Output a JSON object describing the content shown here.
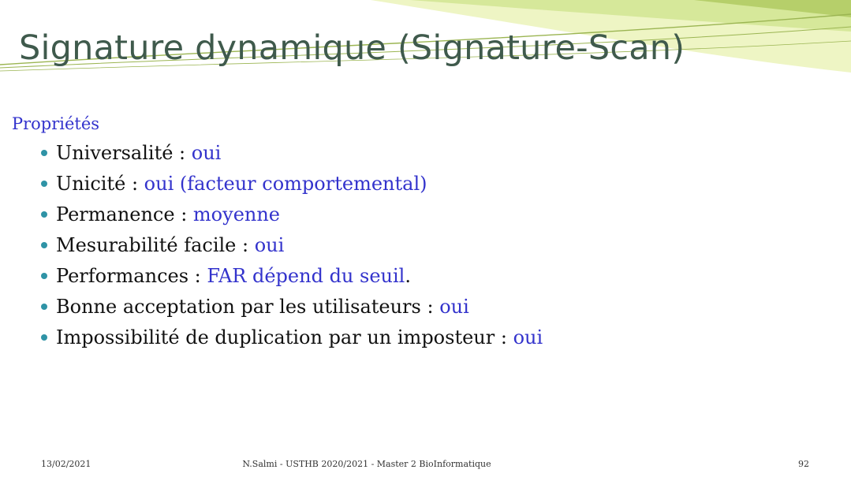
{
  "slide": {
    "title": "Signature dynamique (Signature-Scan)",
    "intro": "Propriétés",
    "bullets": [
      {
        "label": "Universalité",
        "sep": " : ",
        "value": "oui",
        "tail": ""
      },
      {
        "label": "Unicité",
        "sep": " : ",
        "value": "oui (facteur comportemental)",
        "tail": ""
      },
      {
        "label": "Permanence",
        "sep": " : ",
        "value": "moyenne",
        "tail": ""
      },
      {
        "label": "Mesurabilité facile",
        "sep": " : ",
        "value": "oui",
        "tail": ""
      },
      {
        "label": "Performances",
        "sep": " : ",
        "value": "FAR dépend du seuil",
        "tail": "."
      },
      {
        "label": "Bonne acceptation par les utilisateurs",
        "sep": " : ",
        "value": "oui",
        "tail": ""
      },
      {
        "label": "Impossibilité de duplication par un imposteur",
        "sep": " : ",
        "value": "oui",
        "tail": ""
      }
    ]
  },
  "footer": {
    "date": "13/02/2021",
    "center": "N.Salmi - USTHB 2020/2021 - Master 2 BioInformatique",
    "page": "92"
  },
  "colors": {
    "title": "#3f5a4c",
    "accent_blue": "#3333cc",
    "body_text": "#111111",
    "bullet": "#2f93a6",
    "swoosh_light": "#eef5c4",
    "swoosh_mid": "#d6e89a",
    "swoosh_dark": "#b6cf6a",
    "swoosh_line": "#9bb552"
  }
}
